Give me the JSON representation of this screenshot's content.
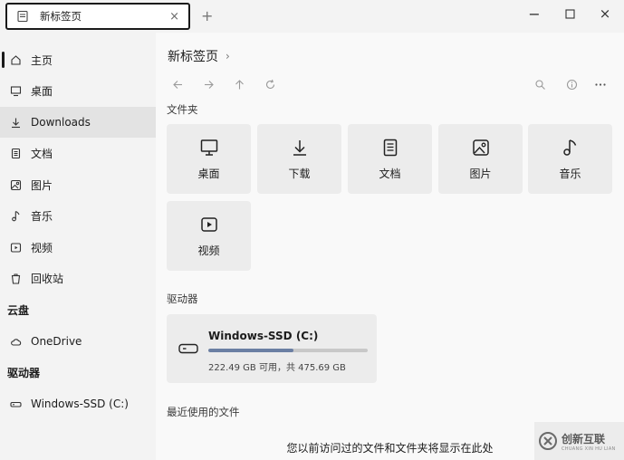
{
  "window": {
    "tab_title": "新标签页",
    "tab_close": "×",
    "new_tab": "+",
    "minimize": "−",
    "maximize": "□",
    "close": "×"
  },
  "sidebar": {
    "items": [
      {
        "label": "主页",
        "icon": "home-icon"
      },
      {
        "label": "桌面",
        "icon": "desktop-icon"
      },
      {
        "label": "Downloads",
        "icon": "download-icon",
        "selected": true
      },
      {
        "label": "文档",
        "icon": "document-icon"
      },
      {
        "label": "图片",
        "icon": "picture-icon"
      },
      {
        "label": "音乐",
        "icon": "music-icon"
      },
      {
        "label": "视频",
        "icon": "video-icon"
      },
      {
        "label": "回收站",
        "icon": "recycle-bin-icon"
      }
    ],
    "cloud_header": "云盘",
    "cloud_items": [
      {
        "label": "OneDrive",
        "icon": "cloud-icon"
      }
    ],
    "drives_header": "驱动器",
    "drive_items": [
      {
        "label": "Windows-SSD (C:)",
        "icon": "drive-icon"
      }
    ]
  },
  "main": {
    "breadcrumb": "新标签页",
    "breadcrumb_chevron": "›",
    "folders_title": "文件夹",
    "folders": [
      {
        "label": "桌面",
        "icon": "desktop-icon"
      },
      {
        "label": "下载",
        "icon": "download-icon"
      },
      {
        "label": "文档",
        "icon": "document-icon"
      },
      {
        "label": "图片",
        "icon": "picture-icon"
      },
      {
        "label": "音乐",
        "icon": "music-icon"
      },
      {
        "label": "视频",
        "icon": "video-icon"
      }
    ],
    "drives_title": "驱动器",
    "drive": {
      "name": "Windows-SSD (C:)",
      "space": "222.49 GB 可用，共 475.69 GB",
      "used_fraction": 0.532
    },
    "recent_title": "最近使用的文件",
    "empty_message": "您以前访问过的文件和文件夹将显示在此处"
  },
  "watermark": {
    "cn": "创新互联",
    "en": "CHUANG XIN HU LIAN"
  },
  "colors": {
    "accent": "#6b7fa3",
    "selected_bg": "#e3e3e3",
    "card_bg": "#ececec"
  }
}
